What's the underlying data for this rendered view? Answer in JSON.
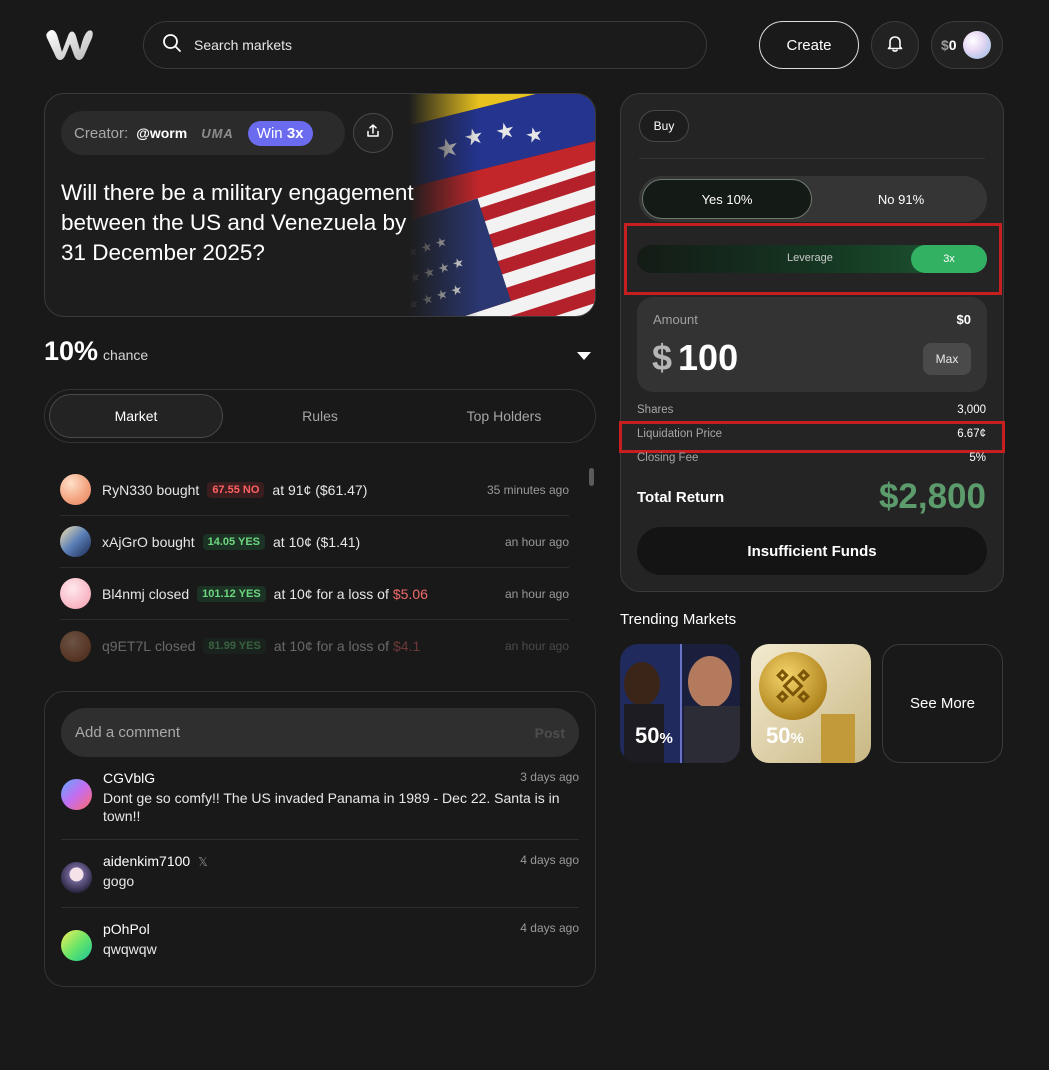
{
  "header": {
    "search_placeholder": "Search markets",
    "create_label": "Create",
    "wallet_currency": "$",
    "wallet_balance": "0"
  },
  "market": {
    "creator_label": "Creator:",
    "creator_name": "@worm",
    "oracle": "UMA",
    "win_prefix": "Win",
    "win_multiplier": "3x",
    "question": "Will there be a military engagement between the US and Venezuela by 31 December 2025?",
    "chance_value": "10%",
    "chance_label": "chance"
  },
  "tabs": [
    "Market",
    "Rules",
    "Top Holders"
  ],
  "activity": [
    {
      "user": "RyN330",
      "action": "bought",
      "shares": "67.55 NO",
      "side": "no",
      "detail": "at 91¢ ($61.47)",
      "loss": "",
      "time": "35 minutes ago"
    },
    {
      "user": "xAjGrO",
      "action": "bought",
      "shares": "14.05 YES",
      "side": "yes",
      "detail": "at 10¢ ($1.41)",
      "loss": "",
      "time": "an hour ago"
    },
    {
      "user": "Bl4nmj",
      "action": "closed",
      "shares": "101.12 YES",
      "side": "yes",
      "detail": "at 10¢ for a loss of",
      "loss": "$5.06",
      "time": "an hour ago"
    },
    {
      "user": "q9ET7L",
      "action": "closed",
      "shares": "81.99 YES",
      "side": "yes",
      "detail": "at 10¢ for a loss of",
      "loss": "$4.1",
      "time": "an hour ago"
    }
  ],
  "comments_section": {
    "placeholder": "Add a comment",
    "post_label": "Post",
    "x_mark": "𝕏",
    "items": [
      {
        "author": "CGVblG",
        "text": " Dont ge so comfy!! The US invaded Panama in 1989 - Dec 22.  Santa is in town!!",
        "time": "3 days ago",
        "verified_x": false
      },
      {
        "author": "aidenkim7100",
        "text": "gogo",
        "time": "4 days ago",
        "verified_x": true
      },
      {
        "author": "pOhPol",
        "text": "qwqwqw",
        "time": "4 days ago",
        "verified_x": false
      }
    ]
  },
  "trade": {
    "mode": "Buy",
    "yes_label": "Yes 10%",
    "no_label": "No 91%",
    "leverage_label": "Leverage",
    "leverage_value": "3x",
    "amount_label": "Amount",
    "amount_balance": "$0",
    "amount_currency": "$",
    "amount_value": "100",
    "max_label": "Max",
    "shares_label": "Shares",
    "shares_value": "3,000",
    "liquidation_label": "Liquidation Price",
    "liquidation_value": "6.67¢",
    "closing_fee_label": "Closing Fee",
    "closing_fee_value": "5%",
    "total_return_label": "Total Return",
    "total_return_value": "$2,800",
    "submit_label": "Insufficient Funds"
  },
  "trending": {
    "title": "Trending Markets",
    "cards": [
      {
        "percent": "50",
        "unit": "%"
      },
      {
        "percent": "50",
        "unit": "%"
      }
    ],
    "see_more_label": "See More"
  },
  "colors": {
    "background": "#191919",
    "yes_green": "#6dd77f",
    "no_red": "#ff6161",
    "accent_purple": "#6b6bef",
    "leverage_green": "#33b163",
    "total_return_green": "#5b9b6c",
    "highlight_red": "#c5201f"
  }
}
